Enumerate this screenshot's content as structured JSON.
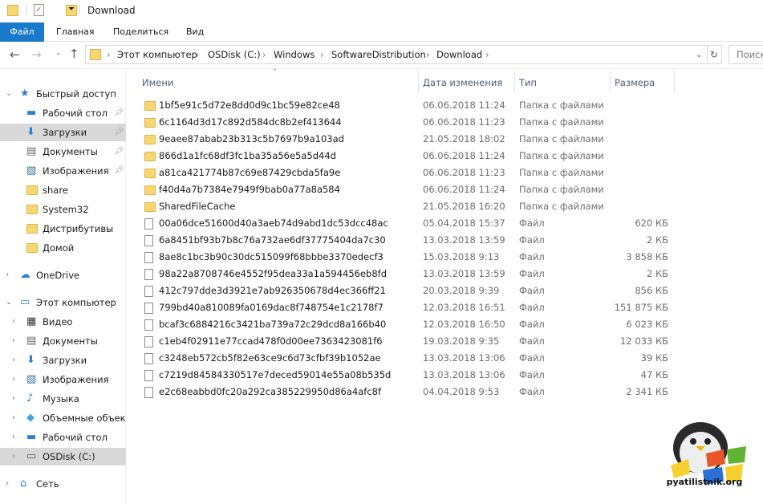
{
  "window": {
    "title": "Download"
  },
  "ribbon": {
    "tabs": [
      "Файл",
      "Главная",
      "Поделиться",
      "Вид"
    ]
  },
  "address": {
    "crumbs": [
      "Этот компьютер",
      "OSDisk (C:)",
      "Windows",
      "SoftwareDistribution",
      "Download"
    ],
    "search_placeholder": "Поиск"
  },
  "nav": {
    "items": [
      {
        "label": "Быстрый доступ",
        "icon": "star-icon",
        "level": 0,
        "chev": "⌄"
      },
      {
        "label": "Рабочий стол",
        "icon": "desktop-icon",
        "level": 1,
        "pin": true
      },
      {
        "label": "Загрузки",
        "icon": "download-icon",
        "level": 1,
        "pin": true,
        "selected": true
      },
      {
        "label": "Документы",
        "icon": "documents-icon",
        "level": 1,
        "pin": true
      },
      {
        "label": "Изображения",
        "icon": "pictures-icon",
        "level": 1,
        "pin": true
      },
      {
        "label": "share",
        "icon": "folder-icon",
        "level": 1
      },
      {
        "label": "System32",
        "icon": "folder-icon",
        "level": 1
      },
      {
        "label": "Дистрибутивы",
        "icon": "folder-icon",
        "level": 1
      },
      {
        "label": "Домой",
        "icon": "folder-icon",
        "level": 1
      },
      {
        "label": "OneDrive",
        "icon": "cloud-icon",
        "level": 0,
        "chev": "›",
        "gap": true
      },
      {
        "label": "Этот компьютер",
        "icon": "computer-icon",
        "level": 0,
        "chev": "⌄",
        "gap": true
      },
      {
        "label": "Видео",
        "icon": "video-icon",
        "level": 1,
        "chev": "›"
      },
      {
        "label": "Документы",
        "icon": "documents-icon",
        "level": 1,
        "chev": "›"
      },
      {
        "label": "Загрузки",
        "icon": "download-icon",
        "level": 1,
        "chev": "›"
      },
      {
        "label": "Изображения",
        "icon": "pictures-icon",
        "level": 1,
        "chev": "›"
      },
      {
        "label": "Музыка",
        "icon": "music-icon",
        "level": 1,
        "chev": "›"
      },
      {
        "label": "Объемные объекты",
        "icon": "3d-objects-icon",
        "level": 1,
        "chev": "›"
      },
      {
        "label": "Рабочий стол",
        "icon": "desktop-icon",
        "level": 1,
        "chev": "›"
      },
      {
        "label": "OSDisk (C:)",
        "icon": "drive-icon",
        "level": 1,
        "chev": "›",
        "selected": true
      },
      {
        "label": "Сеть",
        "icon": "network-icon",
        "level": 0,
        "chev": "›",
        "gap": true
      }
    ]
  },
  "columns": [
    "Имени",
    "Дата изменения",
    "Тип",
    "Размера"
  ],
  "files": [
    {
      "name": "1bf5e91c5d72e8dd0d9c1bc59e82ce48",
      "date": "06.06.2018 11:24",
      "type": "Папка с файлами",
      "size": "",
      "folder": true
    },
    {
      "name": "6c1164d3d17c892d584dc8b2ef413644",
      "date": "06.06.2018 11:23",
      "type": "Папка с файлами",
      "size": "",
      "folder": true
    },
    {
      "name": "9eaee87abab23b313c5b7697b9a103ad",
      "date": "21.05.2018 18:02",
      "type": "Папка с файлами",
      "size": "",
      "folder": true
    },
    {
      "name": "866d1a1fc68df3fc1ba35a56e5a5d44d",
      "date": "06.06.2018 11:24",
      "type": "Папка с файлами",
      "size": "",
      "folder": true
    },
    {
      "name": "a81ca421774b87c69e87429cbda5fa9e",
      "date": "06.06.2018 11:23",
      "type": "Папка с файлами",
      "size": "",
      "folder": true
    },
    {
      "name": "f40d4a7b7384e7949f9bab0a77a8a584",
      "date": "06.06.2018 11:24",
      "type": "Папка с файлами",
      "size": "",
      "folder": true
    },
    {
      "name": "SharedFileCache",
      "date": "21.05.2018 16:20",
      "type": "Папка с файлами",
      "size": "",
      "folder": true
    },
    {
      "name": "00a06dce51600d40a3aeb74d9abd1dc53dcc48ac",
      "date": "05.04.2018 15:37",
      "type": "Файл",
      "size": "620 КБ"
    },
    {
      "name": "6a8451bf93b7b8c76a732ae6df37775404da7c30",
      "date": "13.03.2018 13:59",
      "type": "Файл",
      "size": "2 КБ"
    },
    {
      "name": "8ae8c1bc3b90c30dc515099f68bbbe3370edecf3",
      "date": "15.03.2018 9:13",
      "type": "Файл",
      "size": "3 858 КБ"
    },
    {
      "name": "98a22a8708746e4552f95dea33a1a594456eb8fd",
      "date": "13.03.2018 13:59",
      "type": "Файл",
      "size": "2 КБ"
    },
    {
      "name": "412c797dde3d3921e7ab926350678d4ec366ff21",
      "date": "20.03.2018 9:39",
      "type": "Файл",
      "size": "856 КБ"
    },
    {
      "name": "799bd40a810089fa0169dac8f748754e1c2178f7",
      "date": "12.03.2018 16:51",
      "type": "Файл",
      "size": "151 875 КБ"
    },
    {
      "name": "bcaf3c6884216c3421ba739a72c29dcd8a166b40",
      "date": "12.03.2018 16:50",
      "type": "Файл",
      "size": "6 023 КБ"
    },
    {
      "name": "c1eb4f02911e77ccad478f0d00ee7363423081f6",
      "date": "19.03.2018 9:35",
      "type": "Файл",
      "size": "12 033 КБ"
    },
    {
      "name": "c3248eb572cb5f82e63ce9c6d73cfbf39b1052ae",
      "date": "13.03.2018 13:06",
      "type": "Файл",
      "size": "39 КБ"
    },
    {
      "name": "c7219d84584330517e7deced59014e55a08b535d",
      "date": "13.03.2018 13:06",
      "type": "Файл",
      "size": "47 КБ"
    },
    {
      "name": "e2c68eabbd0fc20a292ca385229950d86a4afc8f",
      "date": "04.04.2018 9:53",
      "type": "Файл",
      "size": "2 341 КБ"
    }
  ],
  "watermark": {
    "text": "pyatilistnik.org"
  },
  "colors": {
    "accent": "#1979ca",
    "selected": "#d9d9d9",
    "folder": "#f7d774"
  }
}
